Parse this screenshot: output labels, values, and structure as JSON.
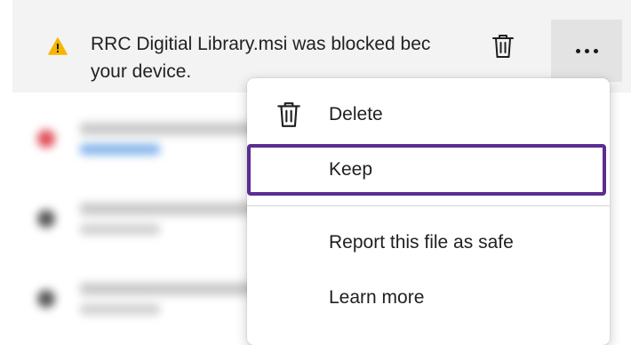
{
  "notification": {
    "message_line1": "RRC Digitial Library.msi was blocked bec",
    "message_line2": "your device.",
    "warning_color": "#f7b500"
  },
  "context_menu": {
    "items": [
      {
        "label": "Delete",
        "icon": "trash-icon"
      },
      {
        "label": "Keep",
        "icon": ""
      },
      {
        "label": "Report this file as safe",
        "icon": ""
      },
      {
        "label": "Learn more",
        "icon": ""
      }
    ],
    "focus_color": "#5c2d91"
  }
}
